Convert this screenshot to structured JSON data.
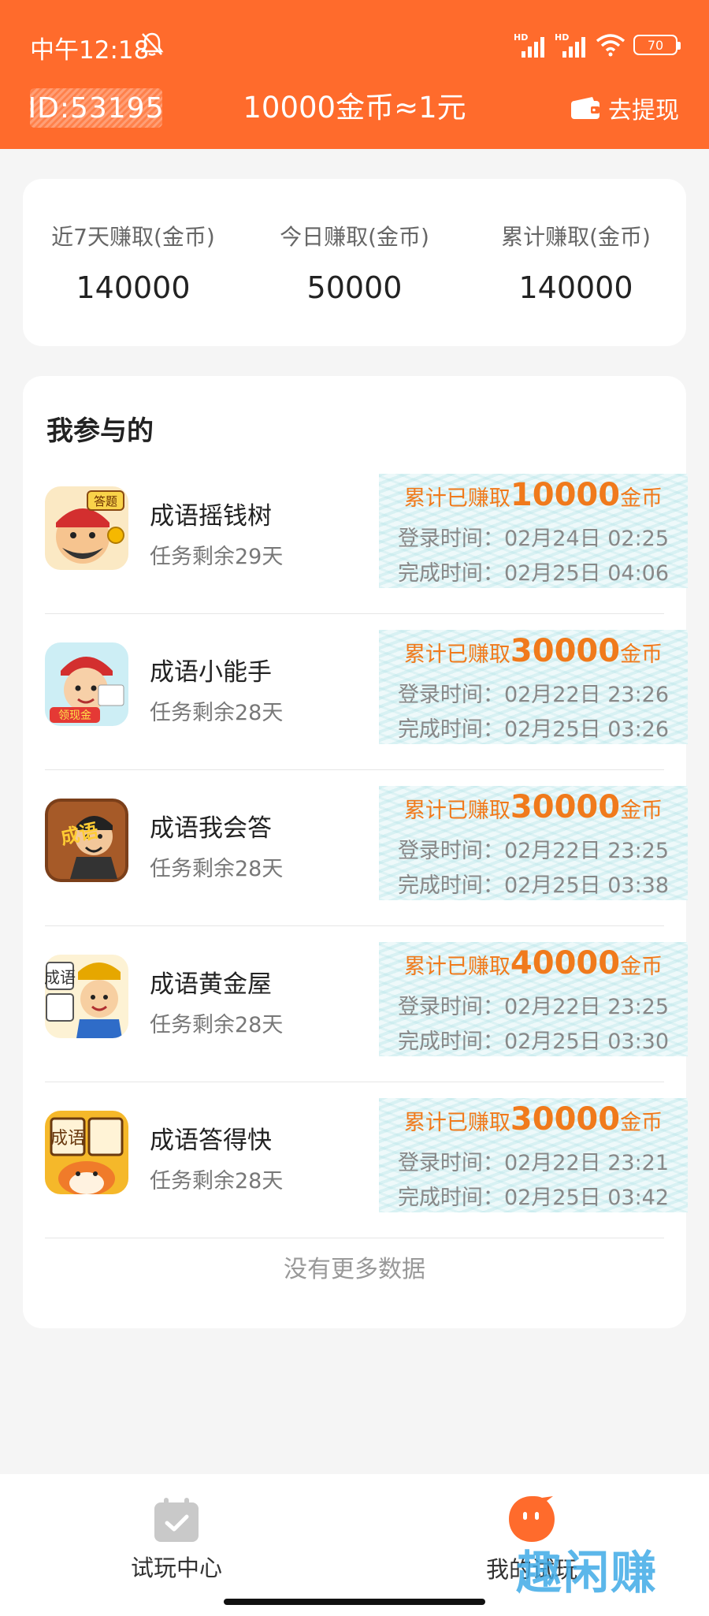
{
  "status_bar": {
    "time": "中午12:18",
    "signal_labels": [
      "HD",
      "HD"
    ],
    "battery": "70"
  },
  "header": {
    "user_id": "ID:53195",
    "rate": "10000金币≈1元",
    "withdraw_label": "去提现"
  },
  "stats": [
    {
      "label": "近7天赚取(金币)",
      "value": "140000"
    },
    {
      "label": "今日赚取(金币)",
      "value": "50000"
    },
    {
      "label": "累计赚取(金币)",
      "value": "140000"
    }
  ],
  "list": {
    "title": "我参与的",
    "earn_prefix": "累计已赚取",
    "earn_suffix": "金币",
    "login_prefix": "登录时间：",
    "done_prefix": "完成时间：",
    "items": [
      {
        "name": "成语摇钱树",
        "remain": "任务剩余29天",
        "coins": "10000",
        "login": "02月24日 02:25",
        "done": "02月25日 04:06",
        "icon": "app-icon-yaoqianshu",
        "badge": "答题"
      },
      {
        "name": "成语小能手",
        "remain": "任务剩余28天",
        "coins": "30000",
        "login": "02月22日 23:26",
        "done": "02月25日 03:26",
        "icon": "app-icon-xiaonengshou",
        "badge": "领现金"
      },
      {
        "name": "成语我会答",
        "remain": "任务剩余28天",
        "coins": "30000",
        "login": "02月22日 23:25",
        "done": "02月25日 03:38",
        "icon": "app-icon-wohuida",
        "badge": "成语"
      },
      {
        "name": "成语黄金屋",
        "remain": "任务剩余28天",
        "coins": "40000",
        "login": "02月22日 23:25",
        "done": "02月25日 03:30",
        "icon": "app-icon-huangjinwu",
        "badge": "成语"
      },
      {
        "name": "成语答得快",
        "remain": "任务剩余28天",
        "coins": "30000",
        "login": "02月22日 23:21",
        "done": "02月25日 03:42",
        "icon": "app-icon-dadekuai",
        "badge": "成语"
      }
    ],
    "no_more": "没有更多数据"
  },
  "bottom_nav": {
    "trial_center": "试玩中心",
    "my_trial": "我的试玩"
  },
  "watermark": "趣闲赚",
  "colors": {
    "brand": "#ff6b2c",
    "earn": "#f07a1c"
  }
}
